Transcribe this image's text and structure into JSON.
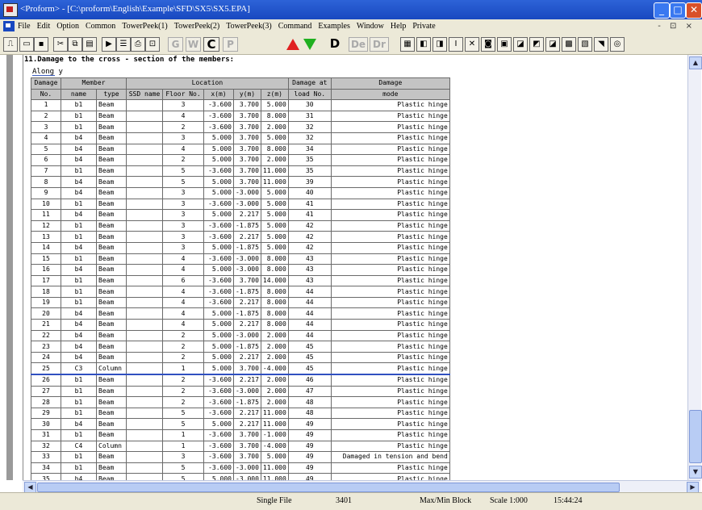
{
  "window": {
    "title": "<Proform> - [C:\\proform\\English\\Example\\SFD\\SX5\\SX5.EPA]"
  },
  "window_controls": {
    "minimize": "_",
    "maximize": "□",
    "close": "✕"
  },
  "menu": [
    "File",
    "Edit",
    "Option",
    "Common",
    "TowerPeek(1)",
    "TowerPeek(2)",
    "TowerPeek(3)",
    "Command",
    "Examples",
    "Window",
    "Help",
    "Private"
  ],
  "mdi_controls": "- ⊡ ×",
  "toolbar": {
    "buttons": [
      "G",
      "W",
      "C",
      "P",
      "D",
      "De",
      "Dr",
      "I"
    ]
  },
  "report": {
    "heading": "11.Damage to the cross - section of the members:",
    "subheading": "Along y",
    "header_row1": [
      "Damage",
      "Member",
      "Location",
      "Damage at",
      "Damage"
    ],
    "header_row2": [
      "No.",
      "name",
      "type",
      "SSD name",
      "Floor No.",
      "x(m)",
      "y(m)",
      "z(m)",
      "load No.",
      "mode"
    ],
    "rows": [
      [
        "1",
        "b1",
        "Beam",
        "",
        "3",
        "-3.600",
        "3.700",
        "5.000",
        "30",
        "Plastic hinge"
      ],
      [
        "2",
        "b1",
        "Beam",
        "",
        "4",
        "-3.600",
        "3.700",
        "8.000",
        "31",
        "Plastic hinge"
      ],
      [
        "3",
        "b1",
        "Beam",
        "",
        "2",
        "-3.600",
        "3.700",
        "2.000",
        "32",
        "Plastic hinge"
      ],
      [
        "4",
        "b4",
        "Beam",
        "",
        "3",
        "5.000",
        "3.700",
        "5.000",
        "32",
        "Plastic hinge"
      ],
      [
        "5",
        "b4",
        "Beam",
        "",
        "4",
        "5.000",
        "3.700",
        "8.000",
        "34",
        "Plastic hinge"
      ],
      [
        "6",
        "b4",
        "Beam",
        "",
        "2",
        "5.000",
        "3.700",
        "2.000",
        "35",
        "Plastic hinge"
      ],
      [
        "7",
        "b1",
        "Beam",
        "",
        "5",
        "-3.600",
        "3.700",
        "11.000",
        "35",
        "Plastic hinge"
      ],
      [
        "8",
        "b4",
        "Beam",
        "",
        "5",
        "5.000",
        "3.700",
        "11.000",
        "39",
        "Plastic hinge"
      ],
      [
        "9",
        "b4",
        "Beam",
        "",
        "3",
        "5.000",
        "-3.000",
        "5.000",
        "40",
        "Plastic hinge"
      ],
      [
        "10",
        "b1",
        "Beam",
        "",
        "3",
        "-3.600",
        "-3.000",
        "5.000",
        "41",
        "Plastic hinge"
      ],
      [
        "11",
        "b4",
        "Beam",
        "",
        "3",
        "5.000",
        "2.217",
        "5.000",
        "41",
        "Plastic hinge"
      ],
      [
        "12",
        "b1",
        "Beam",
        "",
        "3",
        "-3.600",
        "-1.875",
        "5.000",
        "42",
        "Plastic hinge"
      ],
      [
        "13",
        "b1",
        "Beam",
        "",
        "3",
        "-3.600",
        "2.217",
        "5.000",
        "42",
        "Plastic hinge"
      ],
      [
        "14",
        "b4",
        "Beam",
        "",
        "3",
        "5.000",
        "-1.875",
        "5.000",
        "42",
        "Plastic hinge"
      ],
      [
        "15",
        "b1",
        "Beam",
        "",
        "4",
        "-3.600",
        "-3.000",
        "8.000",
        "43",
        "Plastic hinge"
      ],
      [
        "16",
        "b4",
        "Beam",
        "",
        "4",
        "5.000",
        "-3.000",
        "8.000",
        "43",
        "Plastic hinge"
      ],
      [
        "17",
        "b1",
        "Beam",
        "",
        "6",
        "-3.600",
        "3.700",
        "14.000",
        "43",
        "Plastic hinge"
      ],
      [
        "18",
        "b1",
        "Beam",
        "",
        "4",
        "-3.600",
        "-1.875",
        "8.000",
        "44",
        "Plastic hinge"
      ],
      [
        "19",
        "b1",
        "Beam",
        "",
        "4",
        "-3.600",
        "2.217",
        "8.000",
        "44",
        "Plastic hinge"
      ],
      [
        "20",
        "b4",
        "Beam",
        "",
        "4",
        "5.000",
        "-1.875",
        "8.000",
        "44",
        "Plastic hinge"
      ],
      [
        "21",
        "b4",
        "Beam",
        "",
        "4",
        "5.000",
        "2.217",
        "8.000",
        "44",
        "Plastic hinge"
      ],
      [
        "22",
        "b4",
        "Beam",
        "",
        "2",
        "5.000",
        "-3.000",
        "2.000",
        "44",
        "Plastic hinge"
      ],
      [
        "23",
        "b4",
        "Beam",
        "",
        "2",
        "5.000",
        "-1.875",
        "2.000",
        "45",
        "Plastic hinge"
      ],
      [
        "24",
        "b4",
        "Beam",
        "",
        "2",
        "5.000",
        "2.217",
        "2.000",
        "45",
        "Plastic hinge"
      ],
      [
        "25",
        "C3",
        "Column",
        "",
        "1",
        "5.000",
        "3.700",
        "-4.000",
        "45",
        "Plastic hinge"
      ],
      [
        "26",
        "b1",
        "Beam",
        "",
        "2",
        "-3.600",
        "2.217",
        "2.000",
        "46",
        "Plastic hinge"
      ],
      [
        "27",
        "b1",
        "Beam",
        "",
        "2",
        "-3.600",
        "-3.000",
        "2.000",
        "47",
        "Plastic hinge"
      ],
      [
        "28",
        "b1",
        "Beam",
        "",
        "2",
        "-3.600",
        "-1.875",
        "2.000",
        "48",
        "Plastic hinge"
      ],
      [
        "29",
        "b1",
        "Beam",
        "",
        "5",
        "-3.600",
        "2.217",
        "11.000",
        "48",
        "Plastic hinge"
      ],
      [
        "30",
        "b4",
        "Beam",
        "",
        "5",
        "5.000",
        "2.217",
        "11.000",
        "49",
        "Plastic hinge"
      ],
      [
        "31",
        "b1",
        "Beam",
        "",
        "1",
        "-3.600",
        "3.700",
        "-1.000",
        "49",
        "Plastic hinge"
      ],
      [
        "32",
        "C4",
        "Column",
        "",
        "1",
        "-3.600",
        "3.700",
        "-4.000",
        "49",
        "Plastic hinge"
      ],
      [
        "33",
        "b1",
        "Beam",
        "",
        "3",
        "-3.600",
        "3.700",
        "5.000",
        "49",
        "Damaged in tension and bend"
      ],
      [
        "34",
        "b1",
        "Beam",
        "",
        "5",
        "-3.600",
        "-3.000",
        "11.000",
        "49",
        "Plastic hinge"
      ],
      [
        "35",
        "b4",
        "Beam",
        "",
        "5",
        "5.000",
        "-3.000",
        "11.000",
        "49",
        "Plastic hinge"
      ]
    ]
  },
  "statusbar": {
    "mode": "Single File",
    "number": "3401",
    "block": "Max/Min Block",
    "scale": "Scale  1:000",
    "time": "15:44:24"
  }
}
